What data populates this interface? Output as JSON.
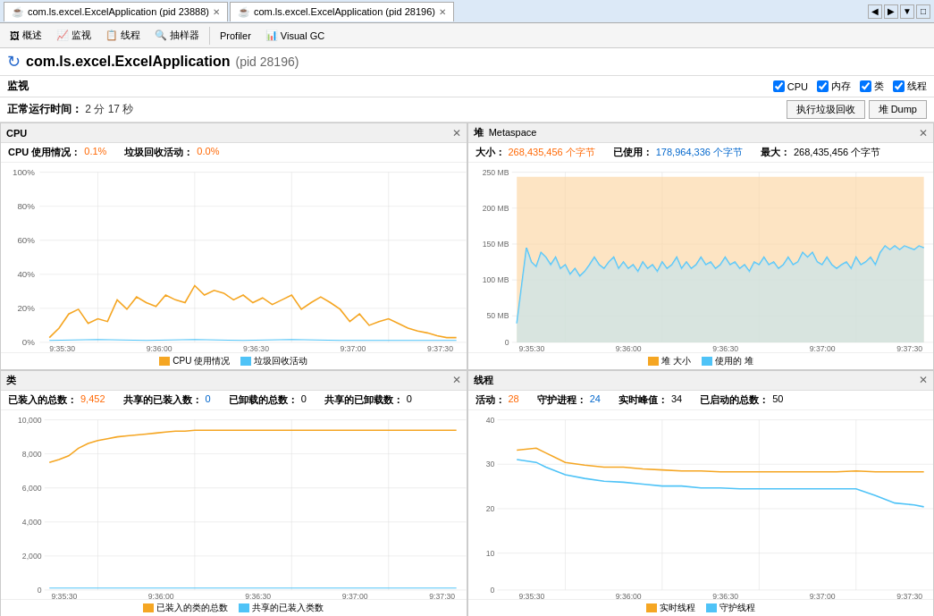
{
  "tabs": [
    {
      "id": "tab1",
      "label": "com.ls.excel.ExcelApplication (pid 23888)",
      "active": false
    },
    {
      "id": "tab2",
      "label": "com.ls.excel.ExcelApplication (pid 28196)",
      "active": true
    }
  ],
  "toolbar": {
    "items": [
      {
        "id": "overview",
        "label": "概述",
        "icon": "📋"
      },
      {
        "id": "monitor",
        "label": "监视",
        "icon": "📊"
      },
      {
        "id": "threads",
        "label": "线程",
        "icon": "📄"
      },
      {
        "id": "sampler",
        "label": "抽样器",
        "icon": "👁"
      },
      {
        "id": "profiler",
        "label": "Profiler",
        "icon": ""
      },
      {
        "id": "visualgc",
        "label": "Visual GC",
        "icon": ""
      }
    ]
  },
  "app": {
    "title": "com.ls.excel.ExcelApplication",
    "pid": "(pid 28196)"
  },
  "monitor": {
    "title": "监视",
    "checkboxes": [
      {
        "id": "cpu",
        "label": "CPU",
        "checked": true
      },
      {
        "id": "memory",
        "label": "内存",
        "checked": true
      },
      {
        "id": "class",
        "label": "类",
        "checked": true
      },
      {
        "id": "thread",
        "label": "线程",
        "checked": true
      }
    ]
  },
  "status": {
    "uptime_label": "正常运行时间：",
    "uptime_value": "2 分 17 秒",
    "btn_gc": "执行垃圾回收",
    "btn_heap_dump": "堆 Dump"
  },
  "panels": {
    "cpu": {
      "title": "CPU",
      "close": "✕",
      "stats": [
        {
          "label": "CPU 使用情况：",
          "value": "0.1%",
          "color": "orange"
        },
        {
          "label": "垃圾回收活动：",
          "value": "0.0%",
          "color": "orange"
        }
      ],
      "legend": [
        {
          "label": "CPU 使用情况",
          "color": "#f5a623"
        },
        {
          "label": "垃圾回收活动",
          "color": "#4fc3f7"
        }
      ],
      "y_labels": [
        "100%",
        "80%",
        "60%",
        "40%",
        "20%",
        "0%"
      ],
      "x_labels": [
        "9:35:30",
        "9:36:00",
        "9:36:30",
        "9:37:00",
        "9:37:30"
      ]
    },
    "heap": {
      "title": "堆",
      "subtitle": "Metaspace",
      "close": "✕",
      "stats": [
        {
          "label": "大小：",
          "value": "268,435,456 个字节",
          "color": "orange"
        },
        {
          "label": "已使用：",
          "value": "178,964,336 个字节",
          "color": "blue"
        },
        {
          "label": "最大：",
          "value": "268,435,456 个字节",
          "color": "black"
        }
      ],
      "legend": [
        {
          "label": "堆 大小",
          "color": "#f5a623"
        },
        {
          "label": "使用的 堆",
          "color": "#4fc3f7"
        }
      ],
      "y_labels": [
        "250 MB",
        "200 MB",
        "150 MB",
        "100 MB",
        "50 MB",
        "0"
      ],
      "x_labels": [
        "9:35:30",
        "9:36:00",
        "9:36:30",
        "9:37:00",
        "9:37:30"
      ]
    },
    "classes": {
      "title": "类",
      "close": "✕",
      "stats": [
        {
          "label": "已装入的总数：",
          "value": "9,452",
          "color": "orange"
        },
        {
          "label": "共享的已装入数：",
          "value": "0",
          "color": "blue"
        },
        {
          "label": "已卸载的总数：",
          "value": "0",
          "color": "black"
        },
        {
          "label": "共享的已卸载数：",
          "value": "0",
          "color": "black"
        }
      ],
      "legend": [
        {
          "label": "已装入的类的总数",
          "color": "#f5a623"
        },
        {
          "label": "共享的已装入类数",
          "color": "#4fc3f7"
        }
      ],
      "y_labels": [
        "10,000",
        "8,000",
        "6,000",
        "4,000",
        "2,000",
        "0"
      ],
      "x_labels": [
        "9:35:30",
        "9:36:00",
        "9:36:30",
        "9:37:00",
        "9:37:30"
      ]
    },
    "threads": {
      "title": "线程",
      "close": "✕",
      "stats": [
        {
          "label": "活动：",
          "value": "28",
          "color": "orange"
        },
        {
          "label": "守护进程：",
          "value": "24",
          "color": "blue"
        },
        {
          "label": "实时峰值：",
          "value": "34",
          "color": "black"
        },
        {
          "label": "已启动的总数：",
          "value": "50",
          "color": "black"
        }
      ],
      "legend": [
        {
          "label": "实时线程",
          "color": "#f5a623"
        },
        {
          "label": "守护线程",
          "color": "#4fc3f7"
        }
      ],
      "y_labels": [
        "40",
        "30",
        "20",
        "10",
        "0"
      ],
      "x_labels": [
        "9:35:30",
        "9:36:00",
        "9:36:30",
        "9:37:00",
        "9:37:30"
      ]
    }
  }
}
